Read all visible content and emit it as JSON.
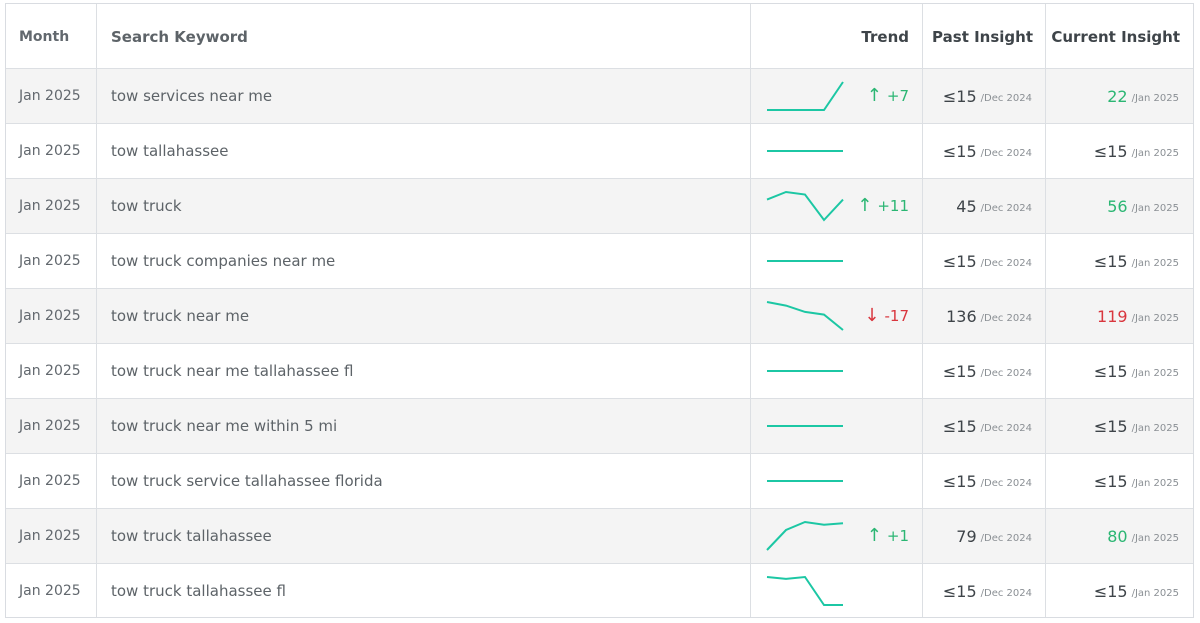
{
  "headers": {
    "month": "Month",
    "keyword": "Search Keyword",
    "trend": "Trend",
    "past": "Past Insight",
    "current": "Current Insight"
  },
  "colors": {
    "sparkline": "#1cc7a4",
    "up": "#2bb673",
    "down": "#d9363e"
  },
  "rows": [
    {
      "month": "Jan 2025",
      "keyword": "tow services near me",
      "spark": [
        15,
        15,
        15,
        15,
        22
      ],
      "delta_dir": "up",
      "delta_arrow": "↑",
      "delta": "+7",
      "past_value": "≤15",
      "past_period": "/Dec 2024",
      "current_value": "22",
      "current_period": "/Jan 2025",
      "current_color": "green"
    },
    {
      "month": "Jan 2025",
      "keyword": "tow tallahassee",
      "spark": [
        15,
        15,
        15,
        15,
        15
      ],
      "delta_dir": "",
      "delta_arrow": "",
      "delta": "",
      "past_value": "≤15",
      "past_period": "/Dec 2024",
      "current_value": "≤15",
      "current_period": "/Jan 2025",
      "current_color": ""
    },
    {
      "month": "Jan 2025",
      "keyword": "tow truck",
      "spark": [
        56,
        62,
        60,
        40,
        56
      ],
      "delta_dir": "up",
      "delta_arrow": "↑",
      "delta": "+11",
      "past_value": "45",
      "past_period": "/Dec 2024",
      "current_value": "56",
      "current_period": "/Jan 2025",
      "current_color": "green"
    },
    {
      "month": "Jan 2025",
      "keyword": "tow truck companies near me",
      "spark": [
        15,
        15,
        15,
        15,
        15
      ],
      "delta_dir": "",
      "delta_arrow": "",
      "delta": "",
      "past_value": "≤15",
      "past_period": "/Dec 2024",
      "current_value": "≤15",
      "current_period": "/Jan 2025",
      "current_color": ""
    },
    {
      "month": "Jan 2025",
      "keyword": "tow truck near me",
      "spark": [
        150,
        146,
        139,
        136,
        119
      ],
      "delta_dir": "down",
      "delta_arrow": "↓",
      "delta": "-17",
      "past_value": "136",
      "past_period": "/Dec 2024",
      "current_value": "119",
      "current_period": "/Jan 2025",
      "current_color": "red"
    },
    {
      "month": "Jan 2025",
      "keyword": "tow truck near me tallahassee fl",
      "spark": [
        15,
        15,
        15,
        15,
        15
      ],
      "delta_dir": "",
      "delta_arrow": "",
      "delta": "",
      "past_value": "≤15",
      "past_period": "/Dec 2024",
      "current_value": "≤15",
      "current_period": "/Jan 2025",
      "current_color": ""
    },
    {
      "month": "Jan 2025",
      "keyword": "tow truck near me within 5 mi",
      "spark": [
        15,
        15,
        15,
        15,
        15
      ],
      "delta_dir": "",
      "delta_arrow": "",
      "delta": "",
      "past_value": "≤15",
      "past_period": "/Dec 2024",
      "current_value": "≤15",
      "current_period": "/Jan 2025",
      "current_color": ""
    },
    {
      "month": "Jan 2025",
      "keyword": "tow truck service tallahassee florida",
      "spark": [
        15,
        15,
        15,
        15,
        15
      ],
      "delta_dir": "",
      "delta_arrow": "",
      "delta": "",
      "past_value": "≤15",
      "past_period": "/Dec 2024",
      "current_value": "≤15",
      "current_period": "/Jan 2025",
      "current_color": ""
    },
    {
      "month": "Jan 2025",
      "keyword": "tow truck tallahassee",
      "spark": [
        60,
        75,
        81,
        79,
        80
      ],
      "delta_dir": "up",
      "delta_arrow": "↑",
      "delta": "+1",
      "past_value": "79",
      "past_period": "/Dec 2024",
      "current_value": "80",
      "current_period": "/Jan 2025",
      "current_color": "green"
    },
    {
      "month": "Jan 2025",
      "keyword": "tow truck tallahassee fl",
      "spark": [
        30,
        29,
        30,
        15,
        15
      ],
      "delta_dir": "",
      "delta_arrow": "",
      "delta": "",
      "past_value": "≤15",
      "past_period": "/Dec 2024",
      "current_value": "≤15",
      "current_period": "/Jan 2025",
      "current_color": ""
    }
  ]
}
